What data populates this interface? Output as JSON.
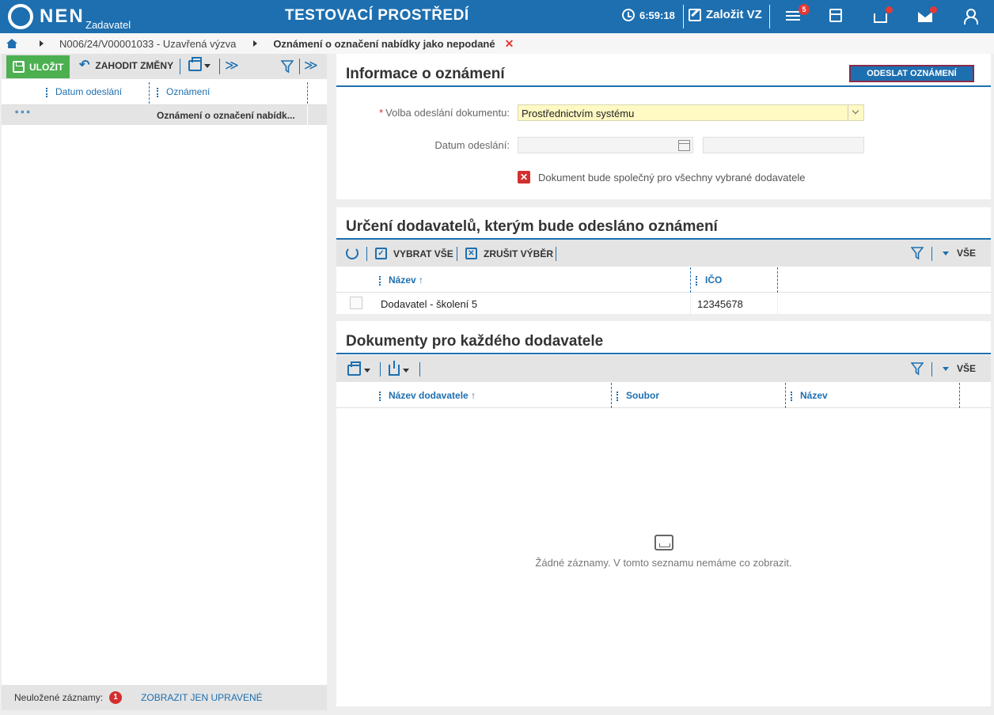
{
  "topbar": {
    "logo_text": "NEN",
    "logo_sub": "Zadavatel",
    "env_title": "TESTOVACÍ PROSTŘEDÍ",
    "time": "6:59:18",
    "create_label": "Založit VZ",
    "menu_badge": "5",
    "accent_color": "#1d6fb0"
  },
  "breadcrumb": {
    "item1": "N006/24/V00001033 - Uzavřená výzva",
    "current": "Oznámení o označení nabídky jako nepodané",
    "close": "✕"
  },
  "left": {
    "save_label": "ULOŽIT",
    "discard_label": "ZAHODIT ZMĚNY",
    "col_date": "Datum odeslání",
    "col_title": "Oznámení",
    "row_more": "∘∘∘",
    "row_title": "Oznámení o označení nabídk...",
    "footer_label": "Neuložené záznamy:",
    "footer_count": "1",
    "footer_link": "ZOBRAZIT JEN UPRAVENÉ"
  },
  "info": {
    "title": "Informace o oznámení",
    "send_button": "ODESLAT OZNÁMENÍ",
    "required_mark": "*",
    "choice_label": "Volba odeslání dokumentu:",
    "choice_value": "Prostřednictvím systému",
    "date_label": "Datum odeslání:",
    "common_doc_label": "Dokument bude společný pro všechny vybrané dodavatele",
    "common_doc_mark": "✕"
  },
  "suppliers": {
    "title": "Určení dodavatelů, kterým bude odesláno oznámení",
    "select_all": "VYBRAT VŠE",
    "deselect": "ZRUŠIT VÝBĚR",
    "all": "VŠE",
    "col_name": "Název",
    "col_ico": "IČO",
    "rows": [
      {
        "name": "Dodavatel - školení 5",
        "ico": "12345678"
      }
    ]
  },
  "docs": {
    "title": "Dokumenty pro každého dodavatele",
    "all": "VŠE",
    "col_supplier": "Název dodavatele",
    "col_file": "Soubor",
    "col_name": "Název",
    "empty": "Žádné záznamy. V tomto seznamu nemáme co zobrazit."
  },
  "sort_arrow": "↑",
  "chevrons": "≫",
  "undo_glyph": "↶"
}
